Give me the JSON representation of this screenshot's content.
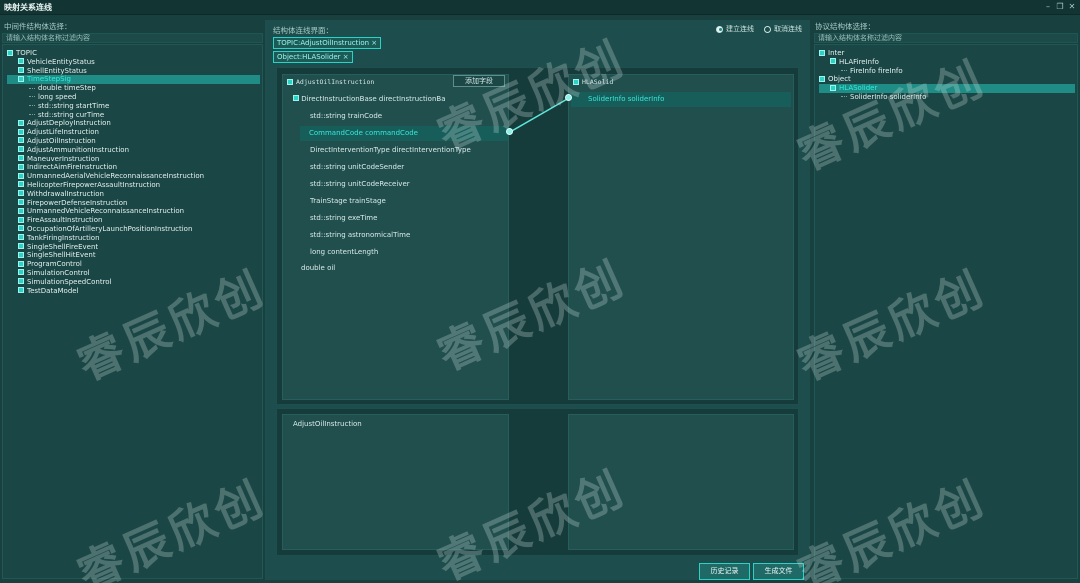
{
  "window": {
    "title": "映射关系连线"
  },
  "left": {
    "label": "中间件结构体选择：",
    "filter_placeholder": "请输入结构体名称过滤内容",
    "tree": [
      {
        "text": "TOPIC",
        "level": 0,
        "box": true,
        "selected": false
      },
      {
        "text": "VehicleEntityStatus",
        "level": 1,
        "box": true,
        "selected": false
      },
      {
        "text": "ShellEntityStatus",
        "level": 1,
        "box": true,
        "selected": false
      },
      {
        "text": "TimeStepSig",
        "level": 1,
        "box": true,
        "selected": true
      },
      {
        "text": "double timeStep",
        "level": 2,
        "box": false,
        "selected": false
      },
      {
        "text": "long speed",
        "level": 2,
        "box": false,
        "selected": false
      },
      {
        "text": "std::string startTime",
        "level": 2,
        "box": false,
        "selected": false
      },
      {
        "text": "std::string curTime",
        "level": 2,
        "box": false,
        "selected": false
      },
      {
        "text": "AdjustDeployInstruction",
        "level": 1,
        "box": true,
        "selected": false
      },
      {
        "text": "AdjustLifeInstruction",
        "level": 1,
        "box": true,
        "selected": false
      },
      {
        "text": "AdjustOilInstruction",
        "level": 1,
        "box": true,
        "selected": false
      },
      {
        "text": "AdjustAmmunitionInstruction",
        "level": 1,
        "box": true,
        "selected": false
      },
      {
        "text": "ManeuverInstruction",
        "level": 1,
        "box": true,
        "selected": false
      },
      {
        "text": "IndirectAimFireInstruction",
        "level": 1,
        "box": true,
        "selected": false
      },
      {
        "text": "UnmannedAerialVehicleReconnaissanceInstruction",
        "level": 1,
        "box": true,
        "selected": false
      },
      {
        "text": "HelicopterFirepowerAssaultInstruction",
        "level": 1,
        "box": true,
        "selected": false
      },
      {
        "text": "WithdrawalInstruction",
        "level": 1,
        "box": true,
        "selected": false
      },
      {
        "text": "FirepowerDefenseInstruction",
        "level": 1,
        "box": true,
        "selected": false
      },
      {
        "text": "UnmannedVehicleReconnaissanceInstruction",
        "level": 1,
        "box": true,
        "selected": false
      },
      {
        "text": "FireAssaultInstruction",
        "level": 1,
        "box": true,
        "selected": false
      },
      {
        "text": "OccupationOfArtilleryLaunchPositionInstruction",
        "level": 1,
        "box": true,
        "selected": false
      },
      {
        "text": "TankFiringInstruction",
        "level": 1,
        "box": true,
        "selected": false
      },
      {
        "text": "SingleShellFireEvent",
        "level": 1,
        "box": true,
        "selected": false
      },
      {
        "text": "SingleShellHitEvent",
        "level": 1,
        "box": true,
        "selected": false
      },
      {
        "text": "ProgramControl",
        "level": 1,
        "box": true,
        "selected": false
      },
      {
        "text": "SimulationControl",
        "level": 1,
        "box": true,
        "selected": false
      },
      {
        "text": "SimulationSpeedControl",
        "level": 1,
        "box": true,
        "selected": false
      },
      {
        "text": "TestDataModel",
        "level": 1,
        "box": true,
        "selected": false
      }
    ]
  },
  "center": {
    "label": "结构体连线界面：",
    "tags": [
      "TOPIC:AdjustOilInstruction ×",
      "Object:HLASolider ×"
    ],
    "radio_connect": "建立连线",
    "radio_cancel": "取消连线",
    "left_struct_title": "AdjustOilInstruction",
    "left_sub_title": "DirectInstructionBase directInstructionBa",
    "fields": [
      "std::string trainCode",
      "CommandCode commandCode",
      "DirectInterventionType directInterventionType",
      "std::string unitCodeSender",
      "std::string unitCodeReceiver",
      "TrainStage trainStage",
      "std::string exeTime",
      "std::string astronomicalTime",
      "long contentLength"
    ],
    "selected_field_index": 1,
    "tail_field": "double oil",
    "show_button": "添加字段",
    "right_struct_title": "HLASolid",
    "right_field": "SoliderInfo soliderInfo",
    "lower_title": "AdjustOilInstruction"
  },
  "right": {
    "label": "协议结构体选择：",
    "filter_placeholder": "请输入结构体名称过滤内容",
    "tree": [
      {
        "text": "Inter",
        "level": 0,
        "box": true,
        "selected": false
      },
      {
        "text": "HLAFireInfo",
        "level": 1,
        "box": true,
        "selected": false
      },
      {
        "text": "FireInfo fireInfo",
        "level": 2,
        "box": false,
        "selected": false
      },
      {
        "text": "Object",
        "level": 0,
        "box": true,
        "selected": false
      },
      {
        "text": "HLASolider",
        "level": 1,
        "box": true,
        "selected": true
      },
      {
        "text": "SoliderInfo soliderInfo",
        "level": 2,
        "box": false,
        "selected": false
      }
    ]
  },
  "buttons": {
    "history": "历史记录",
    "generate": "生成文件"
  },
  "watermark": "睿辰欣创",
  "colors": {
    "accent": "#2ad3c6",
    "selection": "#1f8c85",
    "background": "#17403f"
  }
}
